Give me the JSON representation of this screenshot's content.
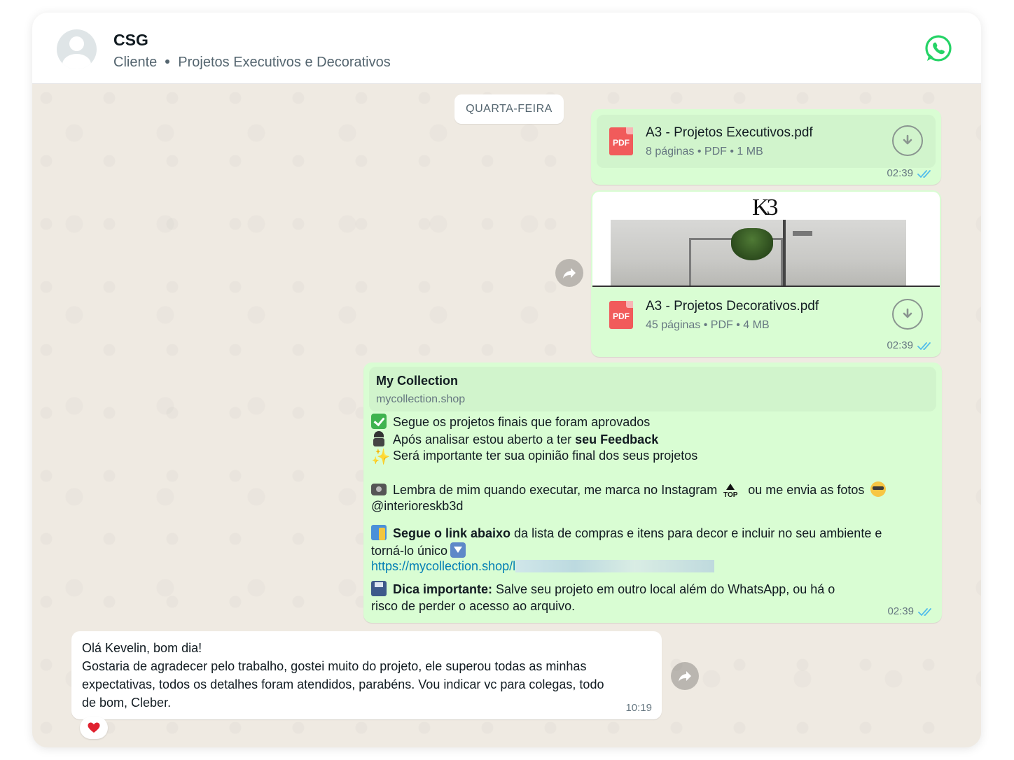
{
  "header": {
    "contact_name": "CSG",
    "subtitle_role": "Cliente",
    "subtitle_business": "Projetos Executivos e Decorativos",
    "app_icon": "whatsapp-icon",
    "colors": {
      "whatsapp_green": "#25d366",
      "outgoing_bubble": "#d9fdd3",
      "read_ticks": "#53bdeb",
      "link": "#027eb5"
    }
  },
  "date_divider": "QUARTA-FEIRA",
  "messages": {
    "doc1": {
      "name": "A3 - Projetos Executivos.pdf",
      "pages": "8 páginas",
      "type": "PDF",
      "size": "1 MB",
      "icon_label": "PDF",
      "time": "02:39"
    },
    "doc2": {
      "brand": "K3",
      "name": "A3 - Projetos Decorativos.pdf",
      "pages": "45 páginas",
      "type": "PDF",
      "size": "4 MB",
      "icon_label": "PDF",
      "time": "02:39"
    },
    "text1": {
      "link_title": "My Collection",
      "link_domain": "mycollection.shop",
      "line1": "Segue os projetos finais que foram aprovados",
      "line2_pre": "Após analisar estou aberto a ter ",
      "line2_bold": "seu Feedback",
      "line3": "Será importante ter sua opinião final dos seus projetos",
      "line4_pre": "Lembra de mim quando executar, me marca no Instagram",
      "line4_top_label": "TOP",
      "line4_post": "ou me envia as fotos",
      "line5": "@interioreskb3d",
      "line6_bold": "Segue o link abaixo",
      "line6_rest": " da lista de compras e itens para decor e incluir no seu ambiente e",
      "line7": "torná-lo único",
      "url": "https://mycollection.shop/l",
      "line9_bold": "Dica importante:",
      "line9_rest": " Salve seu projeto em outro local além do WhatsApp, ou há o",
      "line10": "risco de perder o acesso ao arquivo.",
      "time": "02:39"
    },
    "incoming": {
      "line1": "Olá Kevelin, bom dia!",
      "line2": "Gostaria de agradecer pelo trabalho, gostei muito do projeto, ele superou todas as  minhas",
      "line3": "expectativas, todos os detalhes foram atendidos, parabéns. Vou indicar vc para colegas, todo",
      "line4": "de bom, Cleber.",
      "time": "10:19",
      "reaction": "heart-icon"
    }
  }
}
